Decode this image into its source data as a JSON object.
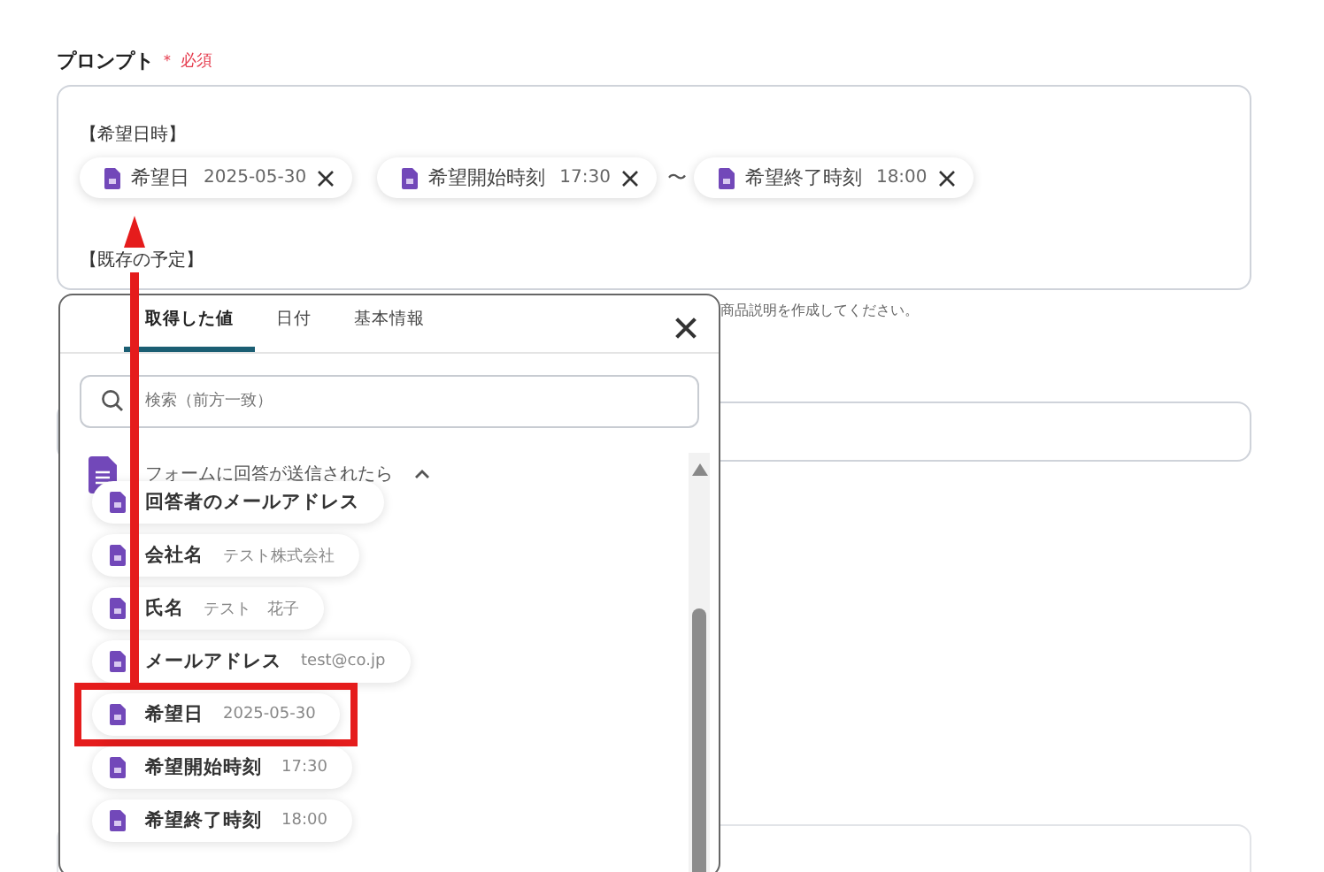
{
  "prompt": {
    "label": "プロンプト",
    "required_mark": "＊",
    "required_text": "必須",
    "blocks": [
      {
        "kind": "heading",
        "text": "【希望日時】"
      },
      {
        "kind": "chips",
        "separator": "〜",
        "chips": [
          {
            "label": "希望日",
            "value": "2025-05-30"
          },
          {
            "label": "希望開始時刻",
            "value": "17:30"
          },
          {
            "label": "希望終了時刻",
            "value": "18:00"
          }
        ]
      },
      {
        "kind": "heading",
        "text": "【既存の予定】"
      }
    ],
    "hint": "商品説明を作成してください。"
  },
  "popup": {
    "tabs": [
      {
        "label": "取得した値",
        "selected": true
      },
      {
        "label": "日付",
        "selected": false
      },
      {
        "label": "基本情報",
        "selected": false
      }
    ],
    "search_placeholder": "検索（前方一致）",
    "group": {
      "title": "フォームに回答が送信されたら",
      "expanded": true,
      "items": [
        {
          "label": "回答者のメールアドレス",
          "highlighted": false
        },
        {
          "label": "会社名",
          "value": "テスト株式会社",
          "highlighted": false
        },
        {
          "label": "氏名",
          "value": "テスト　花子",
          "highlighted": false
        },
        {
          "label": "メールアドレス",
          "value": "test@co.jp",
          "highlighted": false
        },
        {
          "label": "希望日",
          "value": "2025-05-30",
          "highlighted": true
        },
        {
          "label": "希望開始時刻",
          "value": "17:30",
          "highlighted": false
        },
        {
          "label": "希望終了時刻",
          "value": "18:00",
          "highlighted": false
        }
      ]
    }
  }
}
